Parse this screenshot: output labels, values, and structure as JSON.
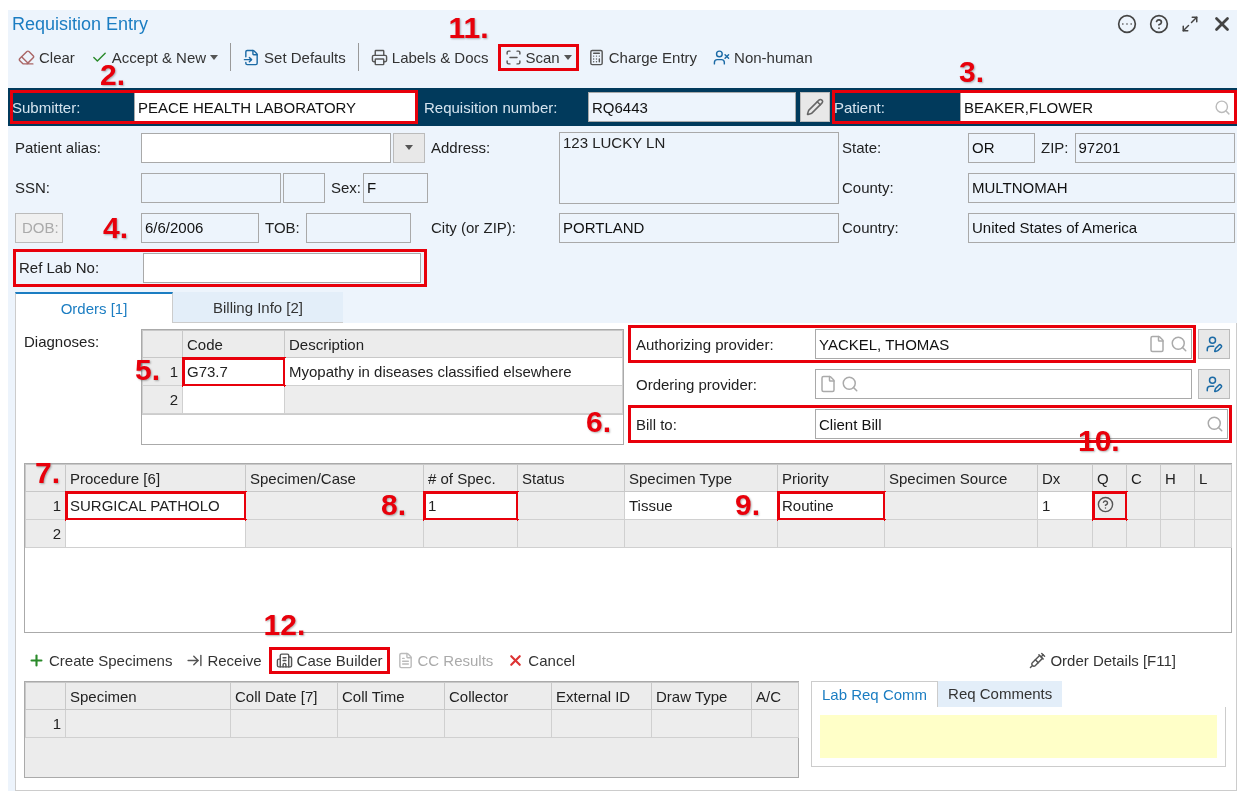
{
  "window": {
    "title": "Requisition Entry"
  },
  "toolbar": [
    {
      "label": "Clear",
      "kind": "button"
    },
    {
      "label": "Accept & New",
      "kind": "dropdown"
    },
    {
      "kind": "separator"
    },
    {
      "label": "Set Defaults",
      "kind": "button"
    },
    {
      "kind": "separator"
    },
    {
      "label": "Labels & Docs",
      "kind": "button"
    },
    {
      "label": "Scan",
      "kind": "dropdown",
      "highlighted": true,
      "callout": "11."
    },
    {
      "label": "Charge Entry",
      "kind": "button"
    },
    {
      "label": "Non-human",
      "kind": "button"
    }
  ],
  "header": {
    "submitter": {
      "label": "Submitter:",
      "value": "PEACE HEALTH LABORATORY",
      "highlighted": true,
      "callout": "2."
    },
    "requisition": {
      "label": "Requisition number:",
      "value": "RQ6443"
    },
    "patient": {
      "label": "Patient:",
      "value": "BEAKER,FLOWER",
      "highlighted": true,
      "callout": "3."
    }
  },
  "demographics": {
    "patient_alias": {
      "label": "Patient alias:"
    },
    "ssn": {
      "label": "SSN:"
    },
    "sex": {
      "label": "Sex:",
      "value": "F"
    },
    "dob": {
      "label": "DOB:",
      "value": "6/6/2006",
      "disabled": true
    },
    "tob": {
      "label": "TOB:"
    },
    "address": {
      "label": "Address:",
      "value": "123 LUCKY LN"
    },
    "city": {
      "label": "City (or ZIP):",
      "value": "PORTLAND"
    },
    "state": {
      "label": "State:",
      "value": "OR"
    },
    "zip": {
      "label": "ZIP:",
      "value": "97201"
    },
    "county": {
      "label": "County:",
      "value": "MULTNOMAH"
    },
    "country": {
      "label": "Country:",
      "value": "United States of America"
    },
    "ref_lab_no": {
      "label": "Ref Lab No:",
      "highlighted": true,
      "callout": "4."
    }
  },
  "tabs": [
    {
      "label": "Orders [1]",
      "selected": true
    },
    {
      "label": "Billing Info [2]",
      "selected": false
    }
  ],
  "diagnoses": {
    "label": "Diagnoses:",
    "columns": [
      "Code",
      "Description"
    ],
    "rows": [
      {
        "number": "1",
        "code": "G73.7",
        "description": "Myopathy in diseases classified elsewhere",
        "highlighted": true,
        "callout": "5."
      },
      {
        "number": "2"
      }
    ]
  },
  "providers": [
    {
      "label": "Authorizing provider:",
      "value": "YACKEL, THOMAS",
      "kind": "provider",
      "highlighted": true
    },
    {
      "label": "Ordering provider:",
      "kind": "provider"
    },
    {
      "label": "Bill to:",
      "value": "Client Bill",
      "kind": "billing",
      "highlighted": true,
      "callout": "6."
    }
  ],
  "procedures": {
    "columns": [
      {
        "label": "Procedure [6]",
        "kind": "text",
        "editable": true,
        "highlighted": true,
        "callout": "7."
      },
      {
        "label": "Specimen/Case",
        "kind": "text",
        "editable": false
      },
      {
        "label": "# of Spec.",
        "kind": "text",
        "editable": true,
        "highlighted": true,
        "callout": "8."
      },
      {
        "label": "Status",
        "kind": "text",
        "editable": false
      },
      {
        "label": "Specimen Type",
        "kind": "text",
        "editable": true
      },
      {
        "label": "Priority",
        "kind": "text",
        "editable": true,
        "highlighted": true,
        "callout": "9."
      },
      {
        "label": "Specimen Source",
        "kind": "text",
        "editable": false
      },
      {
        "label": "Dx",
        "kind": "text",
        "editable": true
      },
      {
        "label": "Q",
        "kind": "query",
        "editable": false,
        "highlighted": true,
        "callout": "10."
      },
      {
        "label": "C",
        "kind": "text",
        "editable": false
      },
      {
        "label": "H",
        "kind": "text",
        "editable": false
      },
      {
        "label": "L",
        "kind": "text",
        "editable": false
      }
    ],
    "rows": [
      {
        "number": "1",
        "query": true,
        "cells": [
          "SURGICAL PATHOLO",
          null,
          "1",
          null,
          "Tissue",
          "Routine",
          null,
          "1",
          null,
          null,
          null,
          null
        ]
      },
      {
        "number": "2",
        "query": false,
        "cells": [
          null,
          null,
          null,
          null,
          null,
          null,
          null,
          null,
          null,
          null,
          null,
          null
        ]
      }
    ]
  },
  "order_actions": [
    {
      "label": "Create Specimens",
      "disabled": false
    },
    {
      "label": "Receive",
      "disabled": false
    },
    {
      "label": "Case Builder",
      "disabled": false,
      "highlighted": true,
      "callout": "12."
    },
    {
      "label": "CC Results",
      "disabled": true
    },
    {
      "label": "Cancel",
      "disabled": false
    }
  ],
  "order_details": {
    "label": "Order Details [F11]"
  },
  "specimens": {
    "columns": [
      "Specimen",
      "Coll Date [7]",
      "Coll Time",
      "Collector",
      "External ID",
      "Draw Type",
      "A/C"
    ],
    "rows": [
      {
        "number": "1"
      }
    ]
  },
  "comments": {
    "tabs": [
      {
        "label": "Lab Req Comm",
        "selected": true
      },
      {
        "label": "Req Comments",
        "selected": false
      }
    ]
  }
}
